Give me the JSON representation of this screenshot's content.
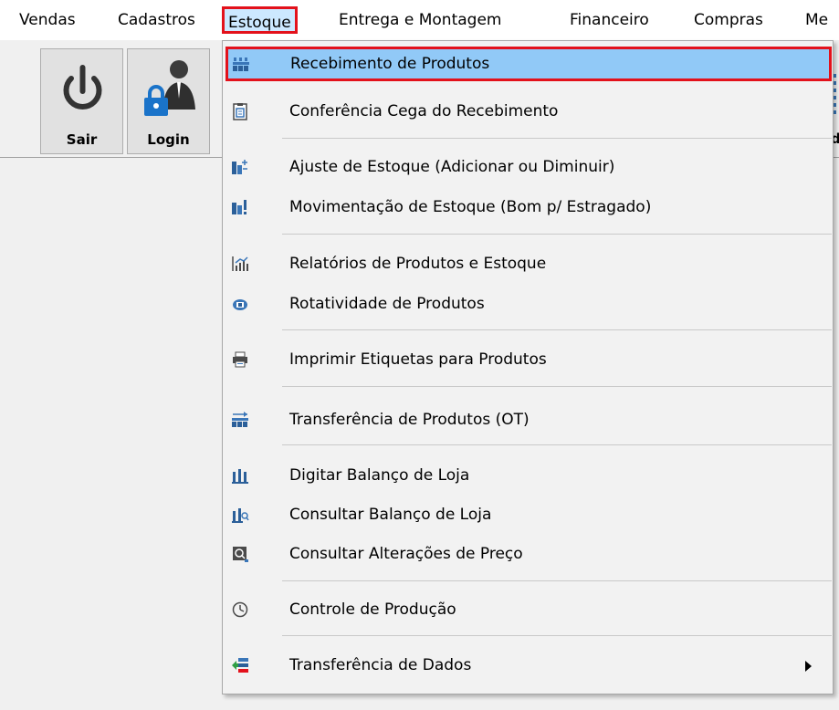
{
  "menubar": {
    "items": [
      {
        "label": "Vendas"
      },
      {
        "label": "Cadastros"
      },
      {
        "label": "Estoque"
      },
      {
        "label": "Entrega e Montagem"
      },
      {
        "label": "Financeiro"
      },
      {
        "label": "Compras"
      },
      {
        "label": "Me"
      }
    ]
  },
  "toolbar": {
    "exit_label": "Sair",
    "login_label": "Login",
    "edge_letter": "d"
  },
  "estoque_menu": {
    "items": [
      {
        "label": "Recebimento de Produtos",
        "icon": "warehouse-icon"
      },
      {
        "label": "Conferência Cega do Recebimento",
        "icon": "clipboard-icon"
      },
      {
        "label": "Ajuste de Estoque  (Adicionar ou Diminuir)",
        "icon": "stock-adjust-icon"
      },
      {
        "label": "Movimentação de Estoque (Bom p/ Estragado)",
        "icon": "stock-move-icon"
      },
      {
        "label": "Relatórios de Produtos e Estoque",
        "icon": "bar-chart-icon"
      },
      {
        "label": "Rotatividade de Produtos",
        "icon": "rotation-icon"
      },
      {
        "label": "Imprimir Etiquetas para Produtos",
        "icon": "printer-icon"
      },
      {
        "label": "Transferência de Produtos (OT)",
        "icon": "transfer-icon"
      },
      {
        "label": "Digitar Balanço de Loja",
        "icon": "balance-icon"
      },
      {
        "label": "Consultar Balanço de Loja",
        "icon": "balance-search-icon"
      },
      {
        "label": "Consultar Alterações de Preço",
        "icon": "price-search-icon"
      },
      {
        "label": "Controle de Produção",
        "icon": "clock-icon"
      },
      {
        "label": "Transferência de Dados",
        "icon": "data-transfer-icon"
      }
    ]
  },
  "colors": {
    "highlight_border": "#e3111b",
    "selected_background": "#91c9f7",
    "active_menu_background": "#cce8ff",
    "icon_blue": "#3a76b8",
    "icon_dark": "#4a4a4a"
  }
}
